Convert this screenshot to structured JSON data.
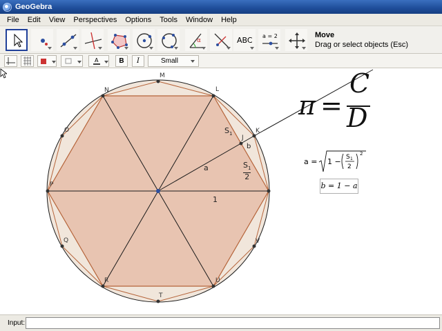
{
  "window": {
    "title": "GeoGebra"
  },
  "menu": {
    "items": [
      "File",
      "Edit",
      "View",
      "Perspectives",
      "Options",
      "Tools",
      "Window",
      "Help"
    ]
  },
  "toolbar": {
    "tools": [
      {
        "name": "move-tool-button",
        "icon": "arrow-pointer-icon",
        "selected": true
      },
      {
        "name": "point-tool-button",
        "icon": "point-icon"
      },
      {
        "name": "line-tool-button",
        "icon": "line-icon"
      },
      {
        "name": "perpendicular-tool-button",
        "icon": "perpendicular-line-icon"
      },
      {
        "name": "polygon-tool-button",
        "icon": "polygon-icon"
      },
      {
        "name": "circle-tool-button",
        "icon": "circle-center-icon"
      },
      {
        "name": "circle-three-points-tool-button",
        "icon": "circle-three-points-icon"
      },
      {
        "name": "angle-tool-button",
        "icon": "angle-icon"
      },
      {
        "name": "reflect-tool-button",
        "icon": "reflect-line-icon"
      },
      {
        "name": "text-tool-button",
        "icon": "text-abc-icon",
        "label": "ABC"
      },
      {
        "name": "slider-tool-button",
        "icon": "slider-icon",
        "label": "a = 2"
      },
      {
        "name": "move-graphics-tool-button",
        "icon": "move-cross-icon"
      }
    ],
    "help": {
      "tool_name": "Move",
      "tool_desc": "Drag or select objects (Esc)"
    }
  },
  "stylebar": {
    "font_size": "Small",
    "bold_label": "B",
    "italic_label": "I"
  },
  "graphics": {
    "formula_pi": {
      "lhs": "π",
      "equals": "=",
      "numerator": "C",
      "denominator": "D"
    },
    "formula_a": "a = √(1 − (S₁/2)²)",
    "formula_b": "b = 1 − a",
    "point_labels": [
      "M",
      "N",
      "L",
      "O",
      "K",
      "J",
      "P",
      "Q",
      "V",
      "R",
      "U",
      "T"
    ],
    "segment_labels": {
      "s1": "S",
      "s1_sub": "1",
      "b": "b",
      "a": "a",
      "half_num": "S",
      "half_sub": "1",
      "half_den": "2",
      "one": "1"
    },
    "colors": {
      "hexagon_fill": "#e8c9b8",
      "circle_fill": "#f0e6dc",
      "polygon_edge": "#c0693e",
      "line": "#1a1a1a"
    }
  },
  "input": {
    "label": "Input:",
    "value": ""
  }
}
